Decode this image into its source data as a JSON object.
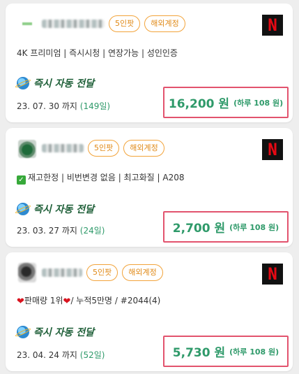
{
  "colors": {
    "accent_green": "#2f9a6a",
    "badge_orange": "#e08a18",
    "price_border": "#e2536e",
    "netflix_red": "#e50914"
  },
  "listings": [
    {
      "badges": [
        "5인팟",
        "해외계정"
      ],
      "description": "4K 프리미엄 | 즉시시청 | 연장가능 | 성인인증",
      "delivery": "즉시 자동 전달",
      "until": "23. 07. 30 까지",
      "days": "(149일)",
      "price": "16,200 원",
      "per_day": "(하루 108 원)",
      "logo": "N"
    },
    {
      "badges": [
        "5인팟",
        "해외계정"
      ],
      "description": "재고한정 | 비번변경 없음 | 최고화질 | A208",
      "delivery": "즉시 자동 전달",
      "until": "23. 03. 27 까지",
      "days": "(24일)",
      "price": "2,700 원",
      "per_day": "(하루 108 원)",
      "logo": "N"
    },
    {
      "badges": [
        "5인팟",
        "해외계정"
      ],
      "description_parts": [
        "판매량 1위",
        "/ 누적5만명 / #2044(4)"
      ],
      "delivery": "즉시 자동 전달",
      "until": "23. 04. 24 까지",
      "days": "(52일)",
      "price": "5,730 원",
      "per_day": "(하루 108 원)",
      "logo": "N"
    }
  ]
}
